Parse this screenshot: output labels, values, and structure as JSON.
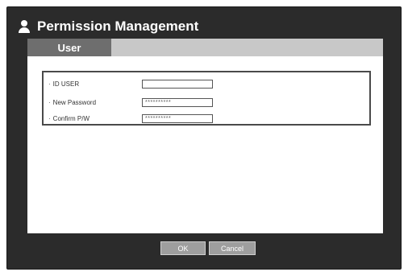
{
  "window": {
    "title": "Permission Management",
    "title_icon": "user-icon"
  },
  "tabs": [
    {
      "label": "User",
      "active": true
    }
  ],
  "form": {
    "fields": [
      {
        "label": "ID USER",
        "value": ""
      },
      {
        "label": "New Password",
        "value": "**********"
      },
      {
        "label": "Confirm P/W",
        "value": "**********"
      }
    ]
  },
  "buttons": {
    "ok": "OK",
    "cancel": "Cancel"
  },
  "colors": {
    "frame": "#2b2b2b",
    "tab_active": "#6e6e6e",
    "tabstrip": "#c8c8c8",
    "button": "#9e9e9e"
  }
}
